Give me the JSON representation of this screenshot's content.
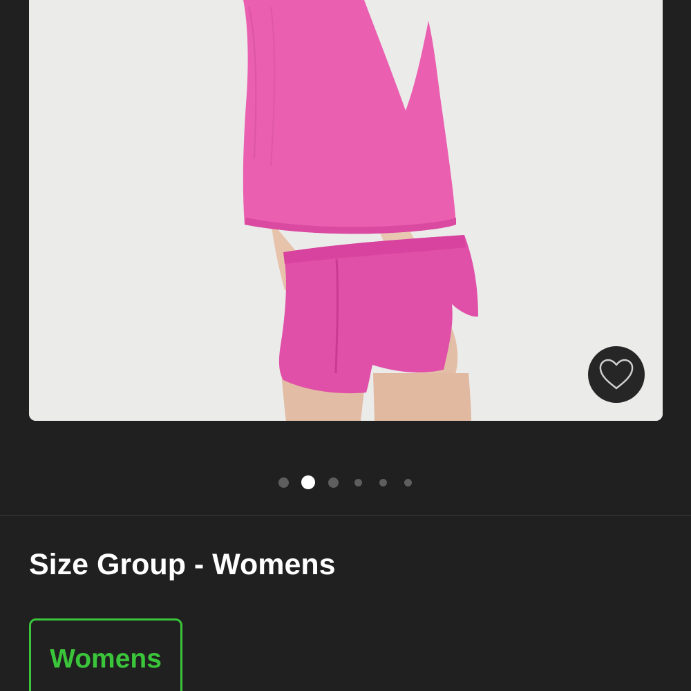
{
  "product": {
    "image_alt": "Pink sleeveless top and pink shorts, back view",
    "favorite_icon": "heart-outline-icon",
    "carousel": {
      "total": 6,
      "active_index": 1
    }
  },
  "size_group": {
    "title": "Size Group - Womens",
    "options": [
      {
        "label": "Womens",
        "selected": true
      }
    ]
  },
  "colors": {
    "background": "#202020",
    "accent_green": "#3ac53a",
    "product_pink": "#e85aae"
  }
}
